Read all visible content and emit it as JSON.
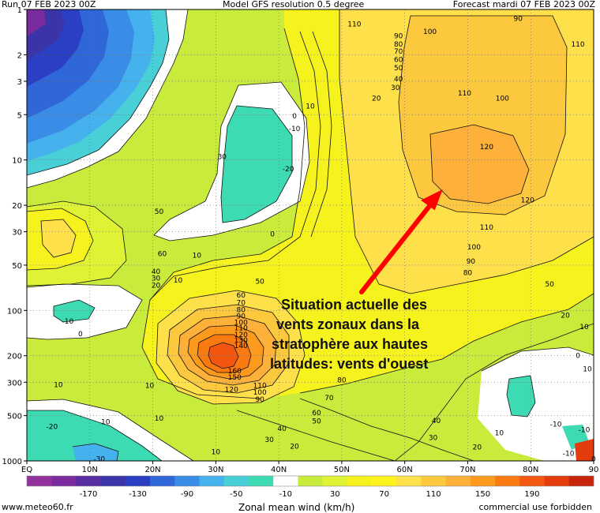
{
  "header": {
    "run": "Run 07 FEB 2023 00Z",
    "model": "Model GFS resolution 0.5 degree",
    "forecast": "Forecast mardi 07 FEB 2023 00Z"
  },
  "chart_data": {
    "type": "contour",
    "title": "",
    "xlabel": "",
    "ylabel": "",
    "x_ticks": [
      "EQ",
      "10N",
      "20N",
      "30N",
      "40N",
      "50N",
      "60N",
      "70N",
      "80N",
      "90"
    ],
    "x_range": [
      0,
      90
    ],
    "y_ticks": [
      1,
      2,
      3,
      5,
      10,
      20,
      30,
      50,
      100,
      200,
      300,
      500,
      1000
    ],
    "y_range": [
      1,
      1000
    ],
    "y_scale": "log",
    "grid": "dotted",
    "contour_labels": [
      {
        "x": 52,
        "y": 1.25,
        "value": "110"
      },
      {
        "x": 64,
        "y": 1.4,
        "value": "100"
      },
      {
        "x": 78,
        "y": 1.15,
        "value": "90"
      },
      {
        "x": 87.5,
        "y": 1.7,
        "value": "110"
      },
      {
        "x": 59,
        "y": 1.5,
        "value": "90"
      },
      {
        "x": 59,
        "y": 1.7,
        "value": "80"
      },
      {
        "x": 59,
        "y": 1.9,
        "value": "70"
      },
      {
        "x": 59,
        "y": 2.15,
        "value": "60"
      },
      {
        "x": 59,
        "y": 2.45,
        "value": "50"
      },
      {
        "x": 59,
        "y": 2.9,
        "value": "40"
      },
      {
        "x": 58.5,
        "y": 3.3,
        "value": "30"
      },
      {
        "x": 55.5,
        "y": 3.9,
        "value": "20"
      },
      {
        "x": 45,
        "y": 4.4,
        "value": "10"
      },
      {
        "x": 42.5,
        "y": 5.1,
        "value": "0"
      },
      {
        "x": 42.5,
        "y": 6.2,
        "value": "-10"
      },
      {
        "x": 41.5,
        "y": 11.5,
        "value": "-20"
      },
      {
        "x": 31,
        "y": 9.5,
        "value": "30"
      },
      {
        "x": 39,
        "y": 31,
        "value": "0"
      },
      {
        "x": 27,
        "y": 43,
        "value": "10"
      },
      {
        "x": 69.5,
        "y": 3.6,
        "value": "110"
      },
      {
        "x": 75.5,
        "y": 3.9,
        "value": "100"
      },
      {
        "x": 73,
        "y": 8.2,
        "value": "120"
      },
      {
        "x": 79.5,
        "y": 18.5,
        "value": "120"
      },
      {
        "x": 73,
        "y": 28,
        "value": "110"
      },
      {
        "x": 71,
        "y": 38,
        "value": "100"
      },
      {
        "x": 70.5,
        "y": 47,
        "value": "90"
      },
      {
        "x": 70,
        "y": 56,
        "value": "80"
      },
      {
        "x": 83,
        "y": 67,
        "value": "50"
      },
      {
        "x": 85.5,
        "y": 108,
        "value": "20"
      },
      {
        "x": 88.5,
        "y": 128,
        "value": "10"
      },
      {
        "x": 21,
        "y": 22,
        "value": "50"
      },
      {
        "x": 21.5,
        "y": 42,
        "value": "60"
      },
      {
        "x": 20.5,
        "y": 55,
        "value": "40"
      },
      {
        "x": 20.5,
        "y": 61,
        "value": "30"
      },
      {
        "x": 20.5,
        "y": 68,
        "value": "20"
      },
      {
        "x": 24,
        "y": 63,
        "value": "10"
      },
      {
        "x": 37,
        "y": 64,
        "value": "50"
      },
      {
        "x": 34,
        "y": 79,
        "value": "60"
      },
      {
        "x": 34,
        "y": 89,
        "value": "70"
      },
      {
        "x": 34,
        "y": 99,
        "value": "80"
      },
      {
        "x": 34,
        "y": 109,
        "value": "90"
      },
      {
        "x": 34,
        "y": 120,
        "value": "100"
      },
      {
        "x": 34,
        "y": 131,
        "value": "110"
      },
      {
        "x": 34,
        "y": 145,
        "value": "120"
      },
      {
        "x": 34,
        "y": 158,
        "value": "130"
      },
      {
        "x": 34,
        "y": 172,
        "value": "140"
      },
      {
        "x": 33,
        "y": 253,
        "value": "160"
      },
      {
        "x": 33,
        "y": 278,
        "value": "150"
      },
      {
        "x": 32.5,
        "y": 335,
        "value": "120"
      },
      {
        "x": 37,
        "y": 315,
        "value": "110"
      },
      {
        "x": 37,
        "y": 350,
        "value": "100"
      },
      {
        "x": 37,
        "y": 390,
        "value": "90"
      },
      {
        "x": 50,
        "y": 290,
        "value": "80"
      },
      {
        "x": 48,
        "y": 380,
        "value": "70"
      },
      {
        "x": 46,
        "y": 480,
        "value": "60"
      },
      {
        "x": 46,
        "y": 545,
        "value": "50"
      },
      {
        "x": 40.5,
        "y": 610,
        "value": "40"
      },
      {
        "x": 38.5,
        "y": 720,
        "value": "30"
      },
      {
        "x": 42.5,
        "y": 800,
        "value": "20"
      },
      {
        "x": 30,
        "y": 870,
        "value": "10"
      },
      {
        "x": 21,
        "y": 520,
        "value": "10"
      },
      {
        "x": 19.5,
        "y": 315,
        "value": "10"
      },
      {
        "x": 65,
        "y": 540,
        "value": "40"
      },
      {
        "x": 64.5,
        "y": 700,
        "value": "30"
      },
      {
        "x": 71.5,
        "y": 810,
        "value": "20"
      },
      {
        "x": 75,
        "y": 650,
        "value": "10"
      },
      {
        "x": 87.5,
        "y": 200,
        "value": "0"
      },
      {
        "x": 89,
        "y": 245,
        "value": "10"
      },
      {
        "x": 84,
        "y": 570,
        "value": "-10"
      },
      {
        "x": 88.5,
        "y": 620,
        "value": "-10"
      },
      {
        "x": 86,
        "y": 890,
        "value": "-10"
      },
      {
        "x": 90,
        "y": 970,
        "value": "0"
      },
      {
        "x": 6.5,
        "y": 118,
        "value": "-10"
      },
      {
        "x": 8.5,
        "y": 143,
        "value": "0"
      },
      {
        "x": 4,
        "y": 590,
        "value": "-20"
      },
      {
        "x": 11.5,
        "y": 970,
        "value": "-30"
      },
      {
        "x": 12.5,
        "y": 550,
        "value": "10"
      },
      {
        "x": 5,
        "y": 312,
        "value": "10"
      }
    ],
    "colorbar": {
      "label": "Zonal mean wind (km/h)",
      "tick_values": [
        -170,
        -130,
        -90,
        -50,
        -10,
        30,
        70,
        110,
        150,
        190
      ],
      "colors": [
        "#93329c",
        "#7a2c9e",
        "#5a2ea3",
        "#3b34a8",
        "#2a3fc4",
        "#2f67d9",
        "#3a8de6",
        "#45b2ee",
        "#49cfd6",
        "#3ddbb3",
        "#ffffff",
        "#c8eb3c",
        "#dff233",
        "#f5f21d",
        "#fff31e",
        "#fee04a",
        "#fcc83e",
        "#fdb03a",
        "#fc9a1d",
        "#f97a11",
        "#f25611",
        "#e33b0c",
        "#c8240c"
      ]
    },
    "annotation": [
      "Situation actuelle des",
      "vents zonaux dans la",
      "stratophère aux hautes",
      "latitudes: vents d'ouest"
    ]
  },
  "footer": {
    "source": "www.meteo60.fr",
    "license": "commercial use forbidden"
  }
}
